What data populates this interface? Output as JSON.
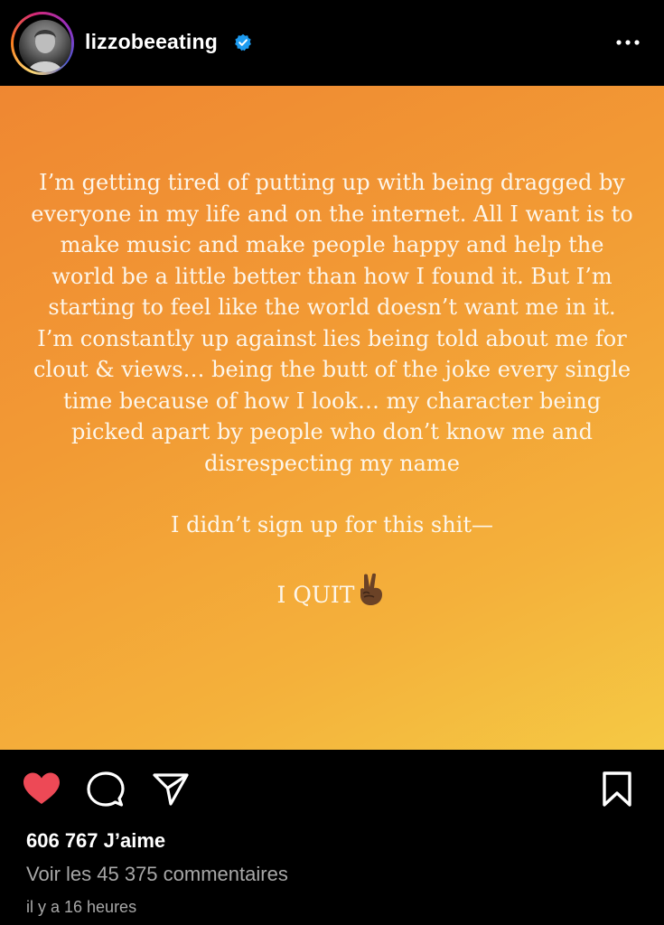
{
  "header": {
    "username": "lizzobeeating",
    "verified_icon": "verified-badge-icon",
    "more_icon": "more-options-icon",
    "ring_colors": [
      "#feda75",
      "#fa7e1e",
      "#d62976",
      "#962fbf",
      "#4f5bd5"
    ]
  },
  "story": {
    "background": [
      "#ef8732",
      "#f5c944"
    ],
    "paragraph": "I’m getting tired of putting up with being dragged by everyone in my life and on the internet. All I want is to make music and make people happy and help the world be a little better than how I found it. But I’m starting to feel like the world doesn’t want me in it. I’m constantly up against lies being told about me for clout & views… being the butt of the joke every single time because of how I look… my character being picked apart by people who don’t know me and disrespecting my name",
    "line2": "I didn’t sign up for this shit—",
    "line3": "I QUIT",
    "emoji": "victory-hand-emoji"
  },
  "actions": {
    "like_icon": "heart-filled-icon",
    "like_color": "#ed4956",
    "comment_icon": "comment-icon",
    "share_icon": "share-icon",
    "save_icon": "bookmark-icon",
    "likes_text": "606 767 J’aime",
    "comments_text": "Voir les 45 375 commentaires",
    "time_text": "il y a 16 heures"
  }
}
